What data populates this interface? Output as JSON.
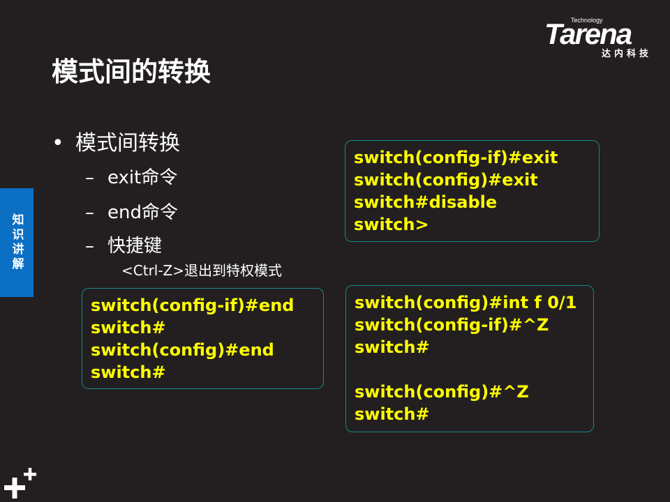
{
  "header": {
    "title": "模式间的转换",
    "logo": {
      "small": "Technology",
      "main": "Tarena",
      "sub": "达内科技"
    }
  },
  "side_tab": {
    "label": "知识讲解"
  },
  "bullets": {
    "main": "模式间转换",
    "items": [
      {
        "dash": "–",
        "text": "exit命令"
      },
      {
        "dash": "–",
        "text": "end命令"
      },
      {
        "dash": "–",
        "text": "快捷键"
      }
    ],
    "sub_note": "<Ctrl-Z>退出到特权模式"
  },
  "boxes": {
    "exit_box": [
      "switch(config-if)#exit",
      "switch(config)#exit",
      "switch#disable",
      "switch>"
    ],
    "end_box": [
      "switch(config-if)#end",
      "switch#",
      "switch(config)#end",
      "switch#"
    ],
    "ctrlz_box": [
      "switch(config)#int f 0/1",
      "switch(config-if)#^Z",
      "switch#",
      "",
      "switch(config)#^Z",
      "switch#"
    ]
  },
  "colors": {
    "background": "#231f20",
    "command_text": "#ffff00",
    "box_border": "#1a8a8a",
    "side_tab": "#0b6fc4"
  }
}
